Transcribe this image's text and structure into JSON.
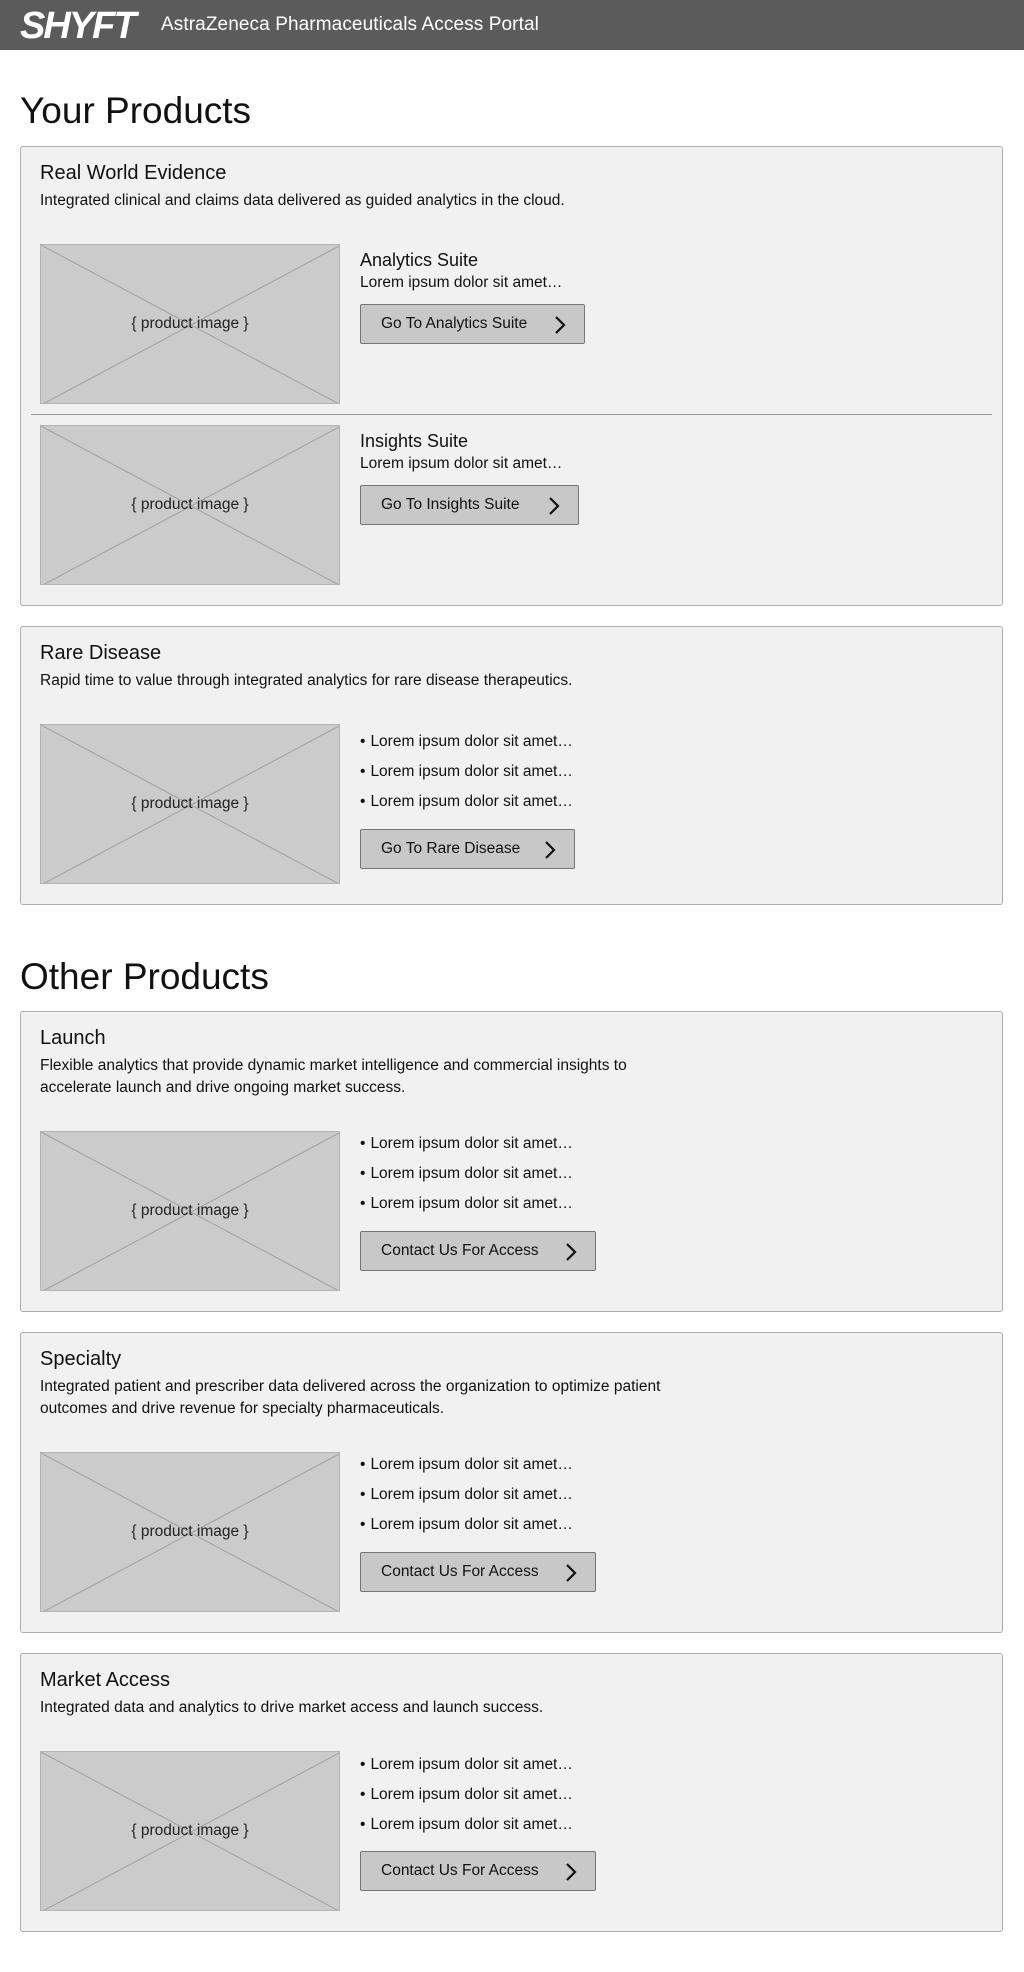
{
  "header": {
    "logo": "SHYFT",
    "title": "AstraZeneca Pharmaceuticals Access Portal"
  },
  "your_products": {
    "heading": "Your Products",
    "real_world_evidence": {
      "title": "Real World Evidence",
      "description": "Integrated clinical and claims data delivered as guided analytics in the cloud.",
      "analytics": {
        "image_label": "{ product image }",
        "title": "Analytics Suite",
        "description": "Lorem ipsum dolor sit amet…",
        "button": "Go To Analytics Suite"
      },
      "insights": {
        "image_label": "{ product image }",
        "title": "Insights Suite",
        "description": "Lorem ipsum dolor sit amet…",
        "button": "Go To Insights Suite"
      }
    },
    "rare_disease": {
      "title": "Rare Disease",
      "description": "Rapid time to value through integrated analytics for rare disease therapeutics.",
      "image_label": "{ product image }",
      "bullets": [
        "Lorem ipsum dolor sit amet…",
        "Lorem ipsum dolor sit amet…",
        "Lorem ipsum dolor sit amet…"
      ],
      "button": "Go To Rare Disease"
    }
  },
  "other_products": {
    "heading": "Other Products",
    "launch": {
      "title": "Launch",
      "description": "Flexible analytics that provide dynamic market intelligence and commercial insights to accelerate launch and drive ongoing market success.",
      "image_label": "{ product image }",
      "bullets": [
        "Lorem ipsum dolor sit amet…",
        "Lorem ipsum dolor sit amet…",
        "Lorem ipsum dolor sit amet…"
      ],
      "button": "Contact Us For Access"
    },
    "specialty": {
      "title": "Specialty",
      "description": "Integrated patient and prescriber data delivered across the organization to optimize patient outcomes and drive revenue for specialty pharmaceuticals.",
      "image_label": "{ product image }",
      "bullets": [
        "Lorem ipsum dolor sit amet…",
        "Lorem ipsum dolor sit amet…",
        "Lorem ipsum dolor sit amet…"
      ],
      "button": "Contact Us For Access"
    },
    "market_access": {
      "title": "Market Access",
      "description": "Integrated data and analytics to drive market access and launch success.",
      "image_label": "{ product image }",
      "bullets": [
        "Lorem ipsum dolor sit amet…",
        "Lorem ipsum dolor sit amet…",
        "Lorem ipsum dolor sit amet…"
      ],
      "button": "Contact Us For Access"
    }
  },
  "icons": {
    "button_arrow": "chevron-right-icon",
    "image_placeholder": "image-placeholder-icon"
  },
  "colors": {
    "header_bg": "#5b5b5b",
    "panel_bg": "#f1f1f1",
    "placeholder_bg": "#cbcbcb",
    "button_bg": "#c8c8c8"
  }
}
